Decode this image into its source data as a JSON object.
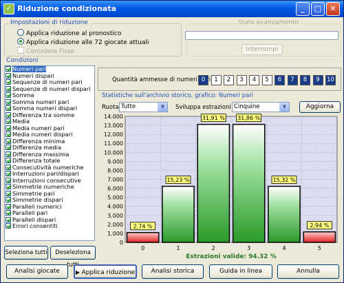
{
  "window": {
    "title": "Riduzione condizionata"
  },
  "settings": {
    "legend": "Impostazioni di riduzione",
    "radio1": "Applica riduzione al pronostico",
    "radio2": "Applica riduzione alle 72 giocate attuali",
    "checkbox": "Considera Fisse"
  },
  "progress": {
    "legend": "Stato avanzamento",
    "value": 0,
    "stop_label": "Interrompi"
  },
  "conditions": {
    "legend": "Condizioni",
    "items": [
      "Numeri pari",
      "Numeri dispari",
      "Sequenze di numeri pari",
      "Sequenze di numeri dispari",
      "Somma",
      "Somma numeri pari",
      "Somma numeri dispari",
      "Differenza tra somme",
      "Media",
      "Media numeri pari",
      "Media numeri dispari",
      "Differenza minima",
      "Differenza media",
      "Differenza massima",
      "Differenza totale",
      "Consecutività numeriche",
      "Interruzioni pari/dispari",
      "Interruzioni consecutive",
      "Simmetrie numeriche",
      "Simmetrie pari",
      "Simmetrie dispari",
      "Paralleli numerici",
      "Paralleli pari",
      "Paralleli dispari",
      "Errori consentiti"
    ],
    "select_all": "Seleziona tutti",
    "deselect_all": "Deseleziona tutti"
  },
  "quantity": {
    "label": "Quantità ammesse di numeri pari:",
    "numbers": [
      "0",
      "1",
      "2",
      "3",
      "4",
      "5",
      "6",
      "7",
      "8",
      "9",
      "10"
    ],
    "selected": [
      "1",
      "2",
      "3",
      "4",
      "5"
    ]
  },
  "stats": {
    "legend": "Statistiche sull'archivio storico, grafico: Numeri pari",
    "ruota_label": "Ruota:",
    "ruota_value": "Tutte",
    "sviluppa_label": "Sviluppa estrazioni in:",
    "sviluppa_value": "Cinquine",
    "refresh": "Aggiorna"
  },
  "chart_data": {
    "type": "bar",
    "categories": [
      "0",
      "1",
      "2",
      "3",
      "4",
      "5"
    ],
    "values": [
      1090,
      6230,
      13110,
      13110,
      6230,
      1170
    ],
    "labels": [
      "2,74 %",
      "15,23 %",
      "31,91 %",
      "31,86 %",
      "15,32 %",
      "2,94 %"
    ],
    "yticks": [
      "0",
      "1.000",
      "2.000",
      "3.000",
      "4.000",
      "5.000",
      "6.000",
      "7.000",
      "8.000",
      "9.000",
      "10.000",
      "11.000",
      "12.000",
      "13.000",
      "14.000"
    ],
    "ylim": [
      0,
      14000
    ],
    "colors": {
      "selected": "#2a9a2a",
      "unselected": "#e02020",
      "background": "#dcdcf0",
      "label_bg": "#ffff80"
    },
    "selected_categories": [
      "1",
      "2",
      "3",
      "4"
    ],
    "footer": "Estrazioni valide: 94.32 %"
  },
  "bottom": {
    "analisi_giocate": "Analisi giocate",
    "applica": "Applica riduzione",
    "analisi_storica": "Analisi storica",
    "guida": "Guida in linea",
    "annulla": "Annulla"
  }
}
